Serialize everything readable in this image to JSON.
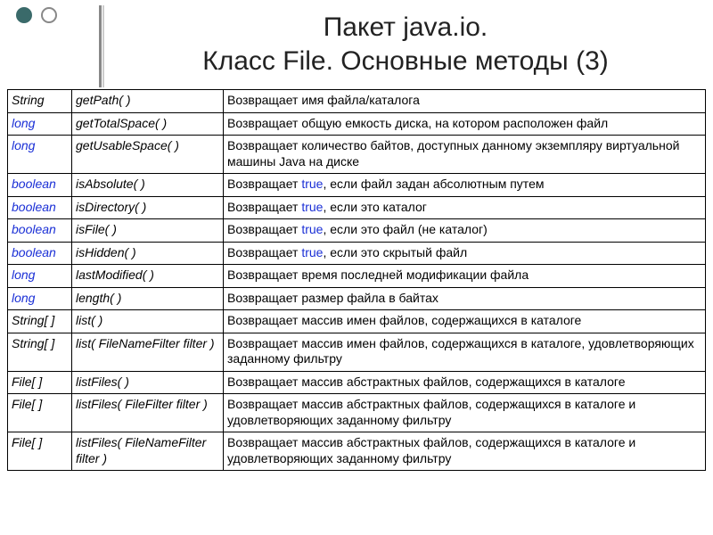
{
  "title": {
    "line1": "Пакет java.io.",
    "line2": "Класс File. Основные методы (3)"
  },
  "rows": [
    {
      "ret": [
        {
          "t": "String"
        }
      ],
      "sig": [
        {
          "t": "getPath( )"
        }
      ],
      "desc": [
        {
          "t": "Возвращает имя файла/каталога"
        }
      ]
    },
    {
      "ret": [
        {
          "t": "long",
          "kw": true
        }
      ],
      "sig": [
        {
          "t": "getTotalSpace( )"
        }
      ],
      "desc": [
        {
          "t": "Возвращает общую емкость диска, на котором расположен файл"
        }
      ]
    },
    {
      "ret": [
        {
          "t": "long",
          "kw": true
        }
      ],
      "sig": [
        {
          "t": "getUsableSpace( )"
        }
      ],
      "desc": [
        {
          "t": "Возвращает количество байтов, доступных данному экземпляру виртуальной машины Java на диске"
        }
      ]
    },
    {
      "ret": [
        {
          "t": "boolean",
          "kw": true
        }
      ],
      "sig": [
        {
          "t": "isAbsolute( )"
        }
      ],
      "desc": [
        {
          "t": "Возвращает "
        },
        {
          "t": "true",
          "kw": true
        },
        {
          "t": ", если файл задан абсолютным путем"
        }
      ]
    },
    {
      "ret": [
        {
          "t": "boolean",
          "kw": true
        }
      ],
      "sig": [
        {
          "t": "isDirectory( )"
        }
      ],
      "desc": [
        {
          "t": "Возвращает "
        },
        {
          "t": "true",
          "kw": true
        },
        {
          "t": ", если это каталог"
        }
      ]
    },
    {
      "ret": [
        {
          "t": "boolean",
          "kw": true
        }
      ],
      "sig": [
        {
          "t": "isFile( )"
        }
      ],
      "desc": [
        {
          "t": "Возвращает "
        },
        {
          "t": "true",
          "kw": true
        },
        {
          "t": ", если это файл (не каталог)"
        }
      ]
    },
    {
      "ret": [
        {
          "t": "boolean",
          "kw": true
        }
      ],
      "sig": [
        {
          "t": "isHidden( )"
        }
      ],
      "desc": [
        {
          "t": "Возвращает "
        },
        {
          "t": "true",
          "kw": true
        },
        {
          "t": ", если это скрытый файл"
        }
      ]
    },
    {
      "ret": [
        {
          "t": "long",
          "kw": true
        }
      ],
      "sig": [
        {
          "t": "lastModified( )"
        }
      ],
      "desc": [
        {
          "t": "Возвращает время последней модификации файла"
        }
      ]
    },
    {
      "ret": [
        {
          "t": "long",
          "kw": true
        }
      ],
      "sig": [
        {
          "t": "length( )"
        }
      ],
      "desc": [
        {
          "t": "Возвращает размер файла в байтах"
        }
      ]
    },
    {
      "ret": [
        {
          "t": "String[ ]"
        }
      ],
      "sig": [
        {
          "t": "list( )"
        }
      ],
      "desc": [
        {
          "t": "Возвращает массив имен файлов, содержащихся в каталоге"
        }
      ]
    },
    {
      "ret": [
        {
          "t": "String[ ]"
        }
      ],
      "sig": [
        {
          "t": "list( FileNameFilter filter )"
        }
      ],
      "desc": [
        {
          "t": "Возвращает массив имен файлов, содержащихся в каталоге, удовлетворяющих заданному фильтру"
        }
      ]
    },
    {
      "ret": [
        {
          "t": "File[ ]"
        }
      ],
      "sig": [
        {
          "t": "listFiles( )"
        }
      ],
      "desc": [
        {
          "t": "Возвращает массив абстрактных файлов, содержащихся в каталоге"
        }
      ]
    },
    {
      "ret": [
        {
          "t": "File[ ]"
        }
      ],
      "sig": [
        {
          "t": "listFiles( FileFilter filter )"
        }
      ],
      "desc": [
        {
          "t": "Возвращает массив абстрактных файлов, содержащихся в каталоге и удовлетворяющих заданному фильтру"
        }
      ]
    },
    {
      "ret": [
        {
          "t": "File[ ]"
        }
      ],
      "sig": [
        {
          "t": "listFiles( FileNameFilter filter )"
        }
      ],
      "desc": [
        {
          "t": "Возвращает массив абстрактных файлов, содержащихся в каталоге и удовлетворяющих заданному фильтру"
        }
      ]
    }
  ]
}
